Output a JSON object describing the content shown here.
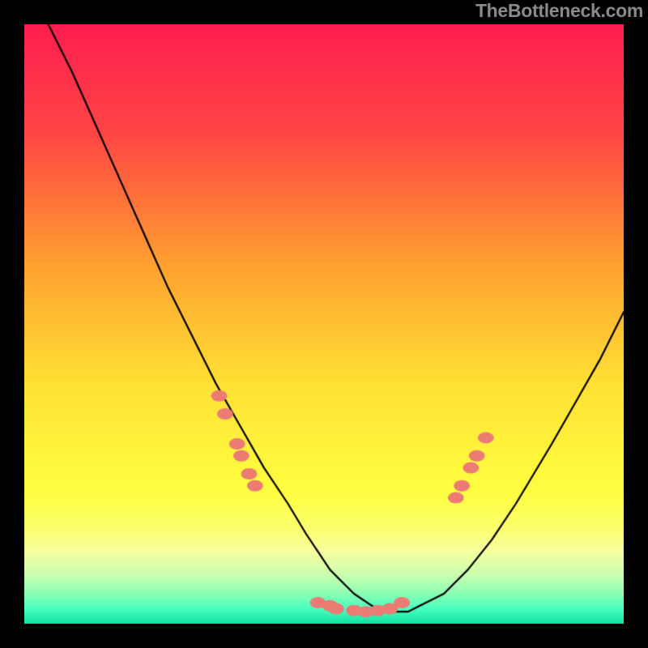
{
  "credit_text": "TheBottleneck.com",
  "chart_data": {
    "type": "line",
    "title": "",
    "xlabel": "",
    "ylabel": "",
    "xlim": [
      0,
      100
    ],
    "ylim": [
      0,
      100
    ],
    "gradient_stops": [
      {
        "pos": 0.0,
        "color": "#ff1e50"
      },
      {
        "pos": 0.18,
        "color": "#ff4545"
      },
      {
        "pos": 0.4,
        "color": "#ffa030"
      },
      {
        "pos": 0.6,
        "color": "#ffe135"
      },
      {
        "pos": 0.78,
        "color": "#ffff40"
      },
      {
        "pos": 0.84,
        "color": "#fcff6c"
      },
      {
        "pos": 0.88,
        "color": "#f4ffa0"
      },
      {
        "pos": 0.92,
        "color": "#c8ffb0"
      },
      {
        "pos": 0.95,
        "color": "#8affb4"
      },
      {
        "pos": 0.975,
        "color": "#4affc0"
      },
      {
        "pos": 1.0,
        "color": "#10e0a0"
      }
    ],
    "series": [
      {
        "name": "bottleneck-curve",
        "stroke": "#000000",
        "x": [
          4,
          8,
          12,
          16,
          20,
          24,
          28,
          32,
          36,
          40,
          44,
          47,
          49,
          51,
          53,
          55,
          58,
          60,
          62,
          64,
          66,
          70,
          74,
          78,
          82,
          85,
          88,
          92,
          96,
          99,
          100
        ],
        "y": [
          100,
          92,
          83,
          74,
          65,
          56,
          48,
          40,
          33,
          26,
          20,
          15,
          12,
          9,
          7,
          5,
          3,
          2,
          2,
          2,
          3,
          5,
          9,
          14,
          20,
          25,
          30,
          37,
          44,
          50,
          52
        ]
      },
      {
        "name": "highlight-markers",
        "style": "marker",
        "color": "#ec7c73",
        "points": [
          {
            "x": 32.5,
            "y": 38
          },
          {
            "x": 33.5,
            "y": 35
          },
          {
            "x": 35.5,
            "y": 30
          },
          {
            "x": 36.2,
            "y": 28
          },
          {
            "x": 37.5,
            "y": 25
          },
          {
            "x": 38.5,
            "y": 23
          },
          {
            "x": 49,
            "y": 3.5
          },
          {
            "x": 51,
            "y": 3
          },
          {
            "x": 52,
            "y": 2.5
          },
          {
            "x": 55,
            "y": 2.2
          },
          {
            "x": 57,
            "y": 2
          },
          {
            "x": 59,
            "y": 2.2
          },
          {
            "x": 61,
            "y": 2.5
          },
          {
            "x": 63,
            "y": 3.5
          },
          {
            "x": 72,
            "y": 21
          },
          {
            "x": 73,
            "y": 23
          },
          {
            "x": 74.5,
            "y": 26
          },
          {
            "x": 75.5,
            "y": 28
          },
          {
            "x": 77,
            "y": 31
          }
        ]
      }
    ]
  }
}
